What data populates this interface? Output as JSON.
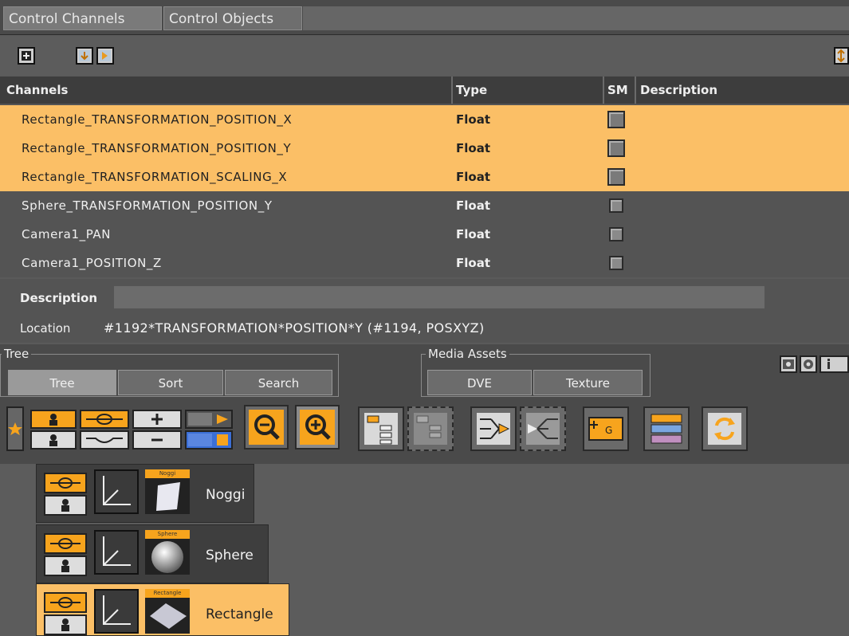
{
  "tabs": [
    {
      "label": "Control Channels"
    },
    {
      "label": "Control Objects"
    }
  ],
  "table": {
    "headers": {
      "channels": "Channels",
      "type": "Type",
      "sm": "SM",
      "description": "Description"
    },
    "rows": [
      {
        "name": "Rectangle_TRANSFORMATION_POSITION_X",
        "type": "Float",
        "selected": true
      },
      {
        "name": "Rectangle_TRANSFORMATION_POSITION_Y",
        "type": "Float",
        "selected": true
      },
      {
        "name": "Rectangle_TRANSFORMATION_SCALING_X",
        "type": "Float",
        "selected": true
      },
      {
        "name": "Sphere_TRANSFORMATION_POSITION_Y",
        "type": "Float",
        "selected": false
      },
      {
        "name": "Camera1_PAN",
        "type": "Float",
        "selected": false
      },
      {
        "name": "Camera1_POSITION_Z",
        "type": "Float",
        "selected": false
      }
    ]
  },
  "details": {
    "description_label": "Description",
    "description_value": "",
    "location_label": "Location",
    "location_value": "#1192*TRANSFORMATION*POSITION*Y (#1194, POSXYZ)"
  },
  "tree_group": {
    "title": "Tree",
    "buttons": [
      {
        "label": "Tree"
      },
      {
        "label": "Sort"
      },
      {
        "label": "Search"
      }
    ]
  },
  "media_group": {
    "title": "Media Assets",
    "buttons": [
      {
        "label": "DVE"
      },
      {
        "label": "Texture"
      }
    ]
  },
  "tree_nodes": [
    {
      "label": "Noggi",
      "thumb_tag": "Noggi",
      "selected": false
    },
    {
      "label": "Sphere",
      "thumb_tag": "Sphere",
      "selected": false
    },
    {
      "label": "Rectangle",
      "thumb_tag": "Rectangle",
      "selected": true
    }
  ],
  "colors": {
    "selection": "#fbbf66",
    "accent": "#f7a41d"
  }
}
